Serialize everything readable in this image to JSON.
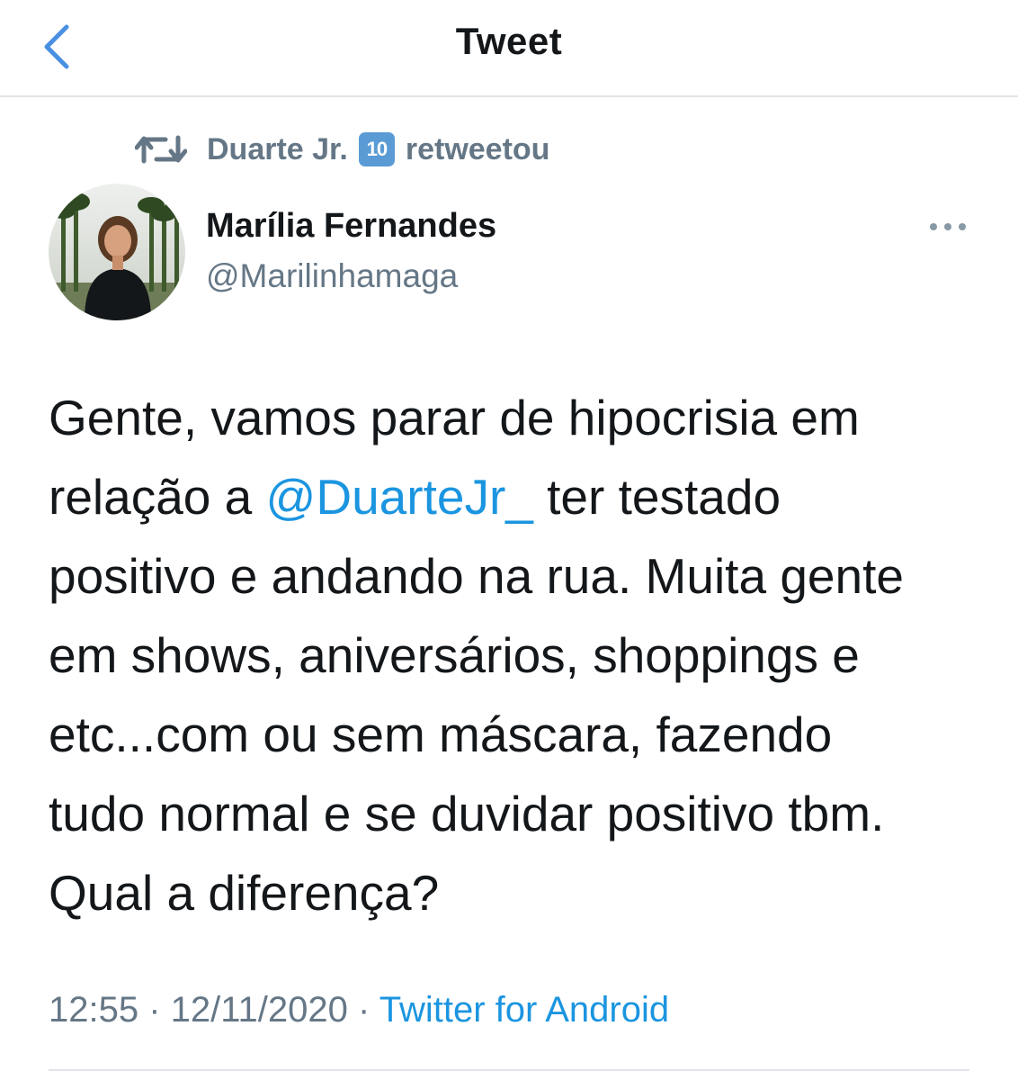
{
  "header": {
    "title": "Tweet",
    "back_icon": "chevron-left-icon"
  },
  "retweet": {
    "icon": "retweet-icon",
    "name": "Duarte Jr.",
    "badge": "10",
    "suffix": "retweetou"
  },
  "author": {
    "name": "Marília Fernandes",
    "handle": "@Marilinhamaga"
  },
  "tweet": {
    "line1": "Gente, vamos parar de hipocrisia em",
    "line2_before": "relação a ",
    "line2_mention": "@DuarteJr_",
    "line2_after": " ter testado",
    "line3": "positivo e andando na rua. Muita gente",
    "line4": "em shows, aniversários, shoppings e",
    "line5": "etc...com ou sem máscara, fazendo",
    "line6": "tudo normal e se duvidar positivo tbm.",
    "line7": "Qual a diferença?"
  },
  "meta": {
    "time": "12:55",
    "sep1": " · ",
    "date": "12/11/2020",
    "sep2": " · ",
    "source": "Twitter for Android"
  },
  "colors": {
    "link": "#1b95e0",
    "secondary_text": "#657786",
    "primary_text": "#14171a",
    "accent_back": "#4a90e2",
    "badge": "#5b9bd5"
  }
}
